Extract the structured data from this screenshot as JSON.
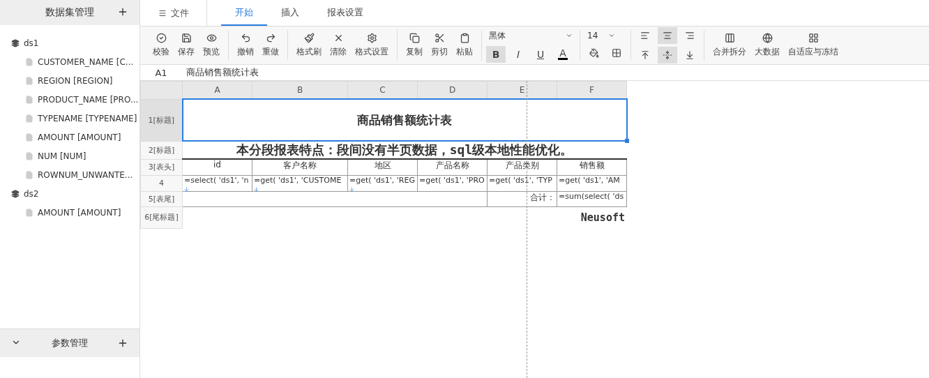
{
  "sidebar": {
    "title": "数据集管理",
    "tree": [
      {
        "label": "ds1",
        "children": [
          {
            "label": "CUSTOMER_NAME [C..."
          },
          {
            "label": "REGION [REGION]"
          },
          {
            "label": "PRODUCT_NAME [PRO..."
          },
          {
            "label": "TYPENAME [TYPENAME]"
          },
          {
            "label": "AMOUNT [AMOUNT]"
          },
          {
            "label": "NUM [NUM]"
          },
          {
            "label": "ROWNUM_UNWANTE..."
          }
        ]
      },
      {
        "label": "ds2",
        "children": [
          {
            "label": "AMOUNT [AMOUNT]"
          }
        ]
      }
    ],
    "footer": {
      "title": "参数管理"
    }
  },
  "menu": {
    "file": "文件",
    "tabs": [
      {
        "label": "开始",
        "selected": true
      },
      {
        "label": "插入",
        "selected": false
      },
      {
        "label": "报表设置",
        "selected": false
      }
    ]
  },
  "toolbar": {
    "groups": [
      {
        "buttons": [
          {
            "label": "校验"
          },
          {
            "label": "保存"
          },
          {
            "label": "预览"
          }
        ]
      },
      {
        "buttons": [
          {
            "label": "撤销"
          },
          {
            "label": "重做"
          }
        ]
      },
      {
        "buttons": [
          {
            "label": "格式刷"
          },
          {
            "label": "清除"
          },
          {
            "label": "格式设置"
          }
        ]
      },
      {
        "buttons": [
          {
            "label": "复制"
          },
          {
            "label": "剪切"
          },
          {
            "label": "粘贴"
          }
        ]
      }
    ],
    "font": {
      "name": "黑体",
      "size": "14",
      "styles": [
        {
          "label": "B",
          "on": true
        },
        {
          "label": "I",
          "on": false
        },
        {
          "label": "U",
          "on": false
        }
      ],
      "color_letter": "A"
    },
    "align": {
      "horizontal": [
        {
          "selected": false
        },
        {
          "selected": true
        },
        {
          "selected": false
        }
      ],
      "vertical": [
        {
          "selected": false
        },
        {
          "selected": true
        },
        {
          "selected": false
        }
      ]
    },
    "extra": [
      {
        "label": "合并拆分"
      },
      {
        "label": "大数据"
      },
      {
        "label": "自适应与冻结"
      }
    ]
  },
  "formula_bar": {
    "cell": "A1",
    "value": "商品销售额统计表"
  },
  "sheet": {
    "columns": [
      "A",
      "B",
      "C",
      "D",
      "E",
      "F"
    ],
    "rows": [
      {
        "header": "1[标题]",
        "kind": "title",
        "text": "商品销售额统计表",
        "selected": true
      },
      {
        "header": "2[标题]",
        "kind": "subtitle",
        "text": "本分段报表特点：段间没有半页数据，sql级本地性能优化。",
        "selected": false
      },
      {
        "header": "3[表头]",
        "kind": "cells",
        "cells": [
          "id",
          "客户名称",
          "地区",
          "产品名称",
          "产品类别",
          "销售额"
        ],
        "selected": false
      },
      {
        "header": "4",
        "kind": "formulas",
        "cells": [
          {
            "text": "=select( 'ds1', 'n",
            "expand": true
          },
          {
            "text": "=get( 'ds1', 'CUSTOME",
            "expand": true
          },
          {
            "text": "=get( 'ds1', 'REG",
            "expand": true
          },
          {
            "text": "=get( 'ds1', 'PRO",
            "expand": false
          },
          {
            "text": "=get( 'ds1', 'TYP",
            "expand": false
          },
          {
            "text": "=get( 'ds1', 'AM",
            "expand": false
          }
        ],
        "selected": false
      },
      {
        "header": "5[表尾]",
        "kind": "total",
        "label": "合计：",
        "formula": "=sum(select( 'ds",
        "selected": false
      },
      {
        "header": "6[尾标题]",
        "kind": "footer",
        "signature": "Neusoft",
        "selected": false
      }
    ]
  }
}
